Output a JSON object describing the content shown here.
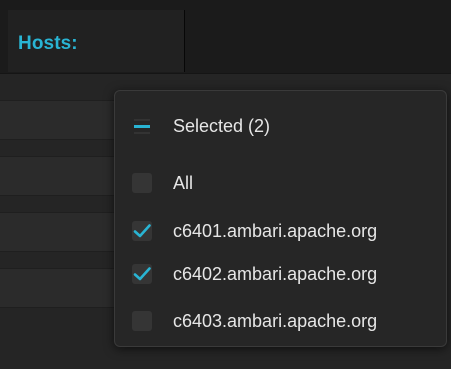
{
  "header": {
    "title": "Hosts:"
  },
  "filter": {
    "selected_label": "Selected (2)",
    "all_label": "All",
    "options": [
      {
        "label": "c6401.ambari.apache.org",
        "checked": true
      },
      {
        "label": "c6402.ambari.apache.org",
        "checked": true
      },
      {
        "label": "c6403.ambari.apache.org",
        "checked": false
      }
    ]
  },
  "colors": {
    "accent": "#29b4d3"
  },
  "icons": {
    "selected": "minus-icon",
    "checked": "checkmark-icon"
  }
}
